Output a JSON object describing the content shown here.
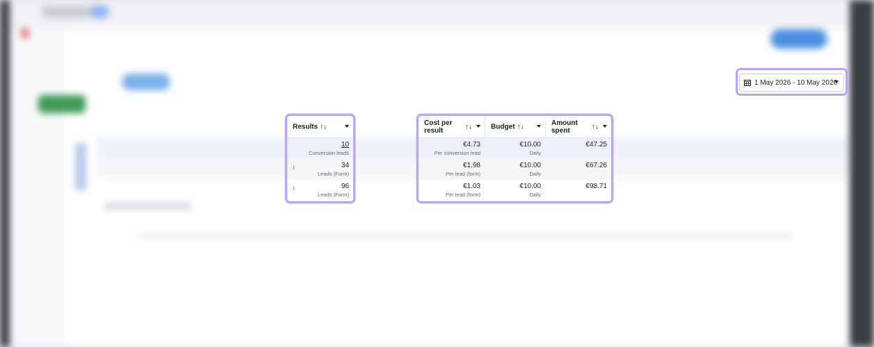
{
  "date_range": {
    "label": "1 May 2026 - 10 May 2026"
  },
  "results_table": {
    "header": "Results",
    "rows": [
      {
        "value": "10",
        "sub": "Conversion leads"
      },
      {
        "value": "34",
        "sub": "Leads (Form)"
      },
      {
        "value": "96",
        "sub": "Leads (Form)"
      }
    ]
  },
  "cost_table": {
    "headers": {
      "cost_per_result": "Cost per result",
      "budget": "Budget",
      "amount_spent": "Amount spent"
    },
    "rows": [
      {
        "cost": "€4.73",
        "cost_sub": "Per conversion lead",
        "budget": "€10.00",
        "budget_sub": "Daily",
        "spent": "€47.25"
      },
      {
        "cost": "€1.98",
        "cost_sub": "Per lead (form)",
        "budget": "€10.00",
        "budget_sub": "Daily",
        "spent": "€67.26"
      },
      {
        "cost": "€1.03",
        "cost_sub": "Per lead (form)",
        "budget": "€10.00",
        "budget_sub": "Daily",
        "spent": "€98.71"
      }
    ]
  },
  "colors": {
    "highlight": "#b9a4f7",
    "selected_row": "#eef1fb",
    "alt_row": "#f5f6f7"
  }
}
